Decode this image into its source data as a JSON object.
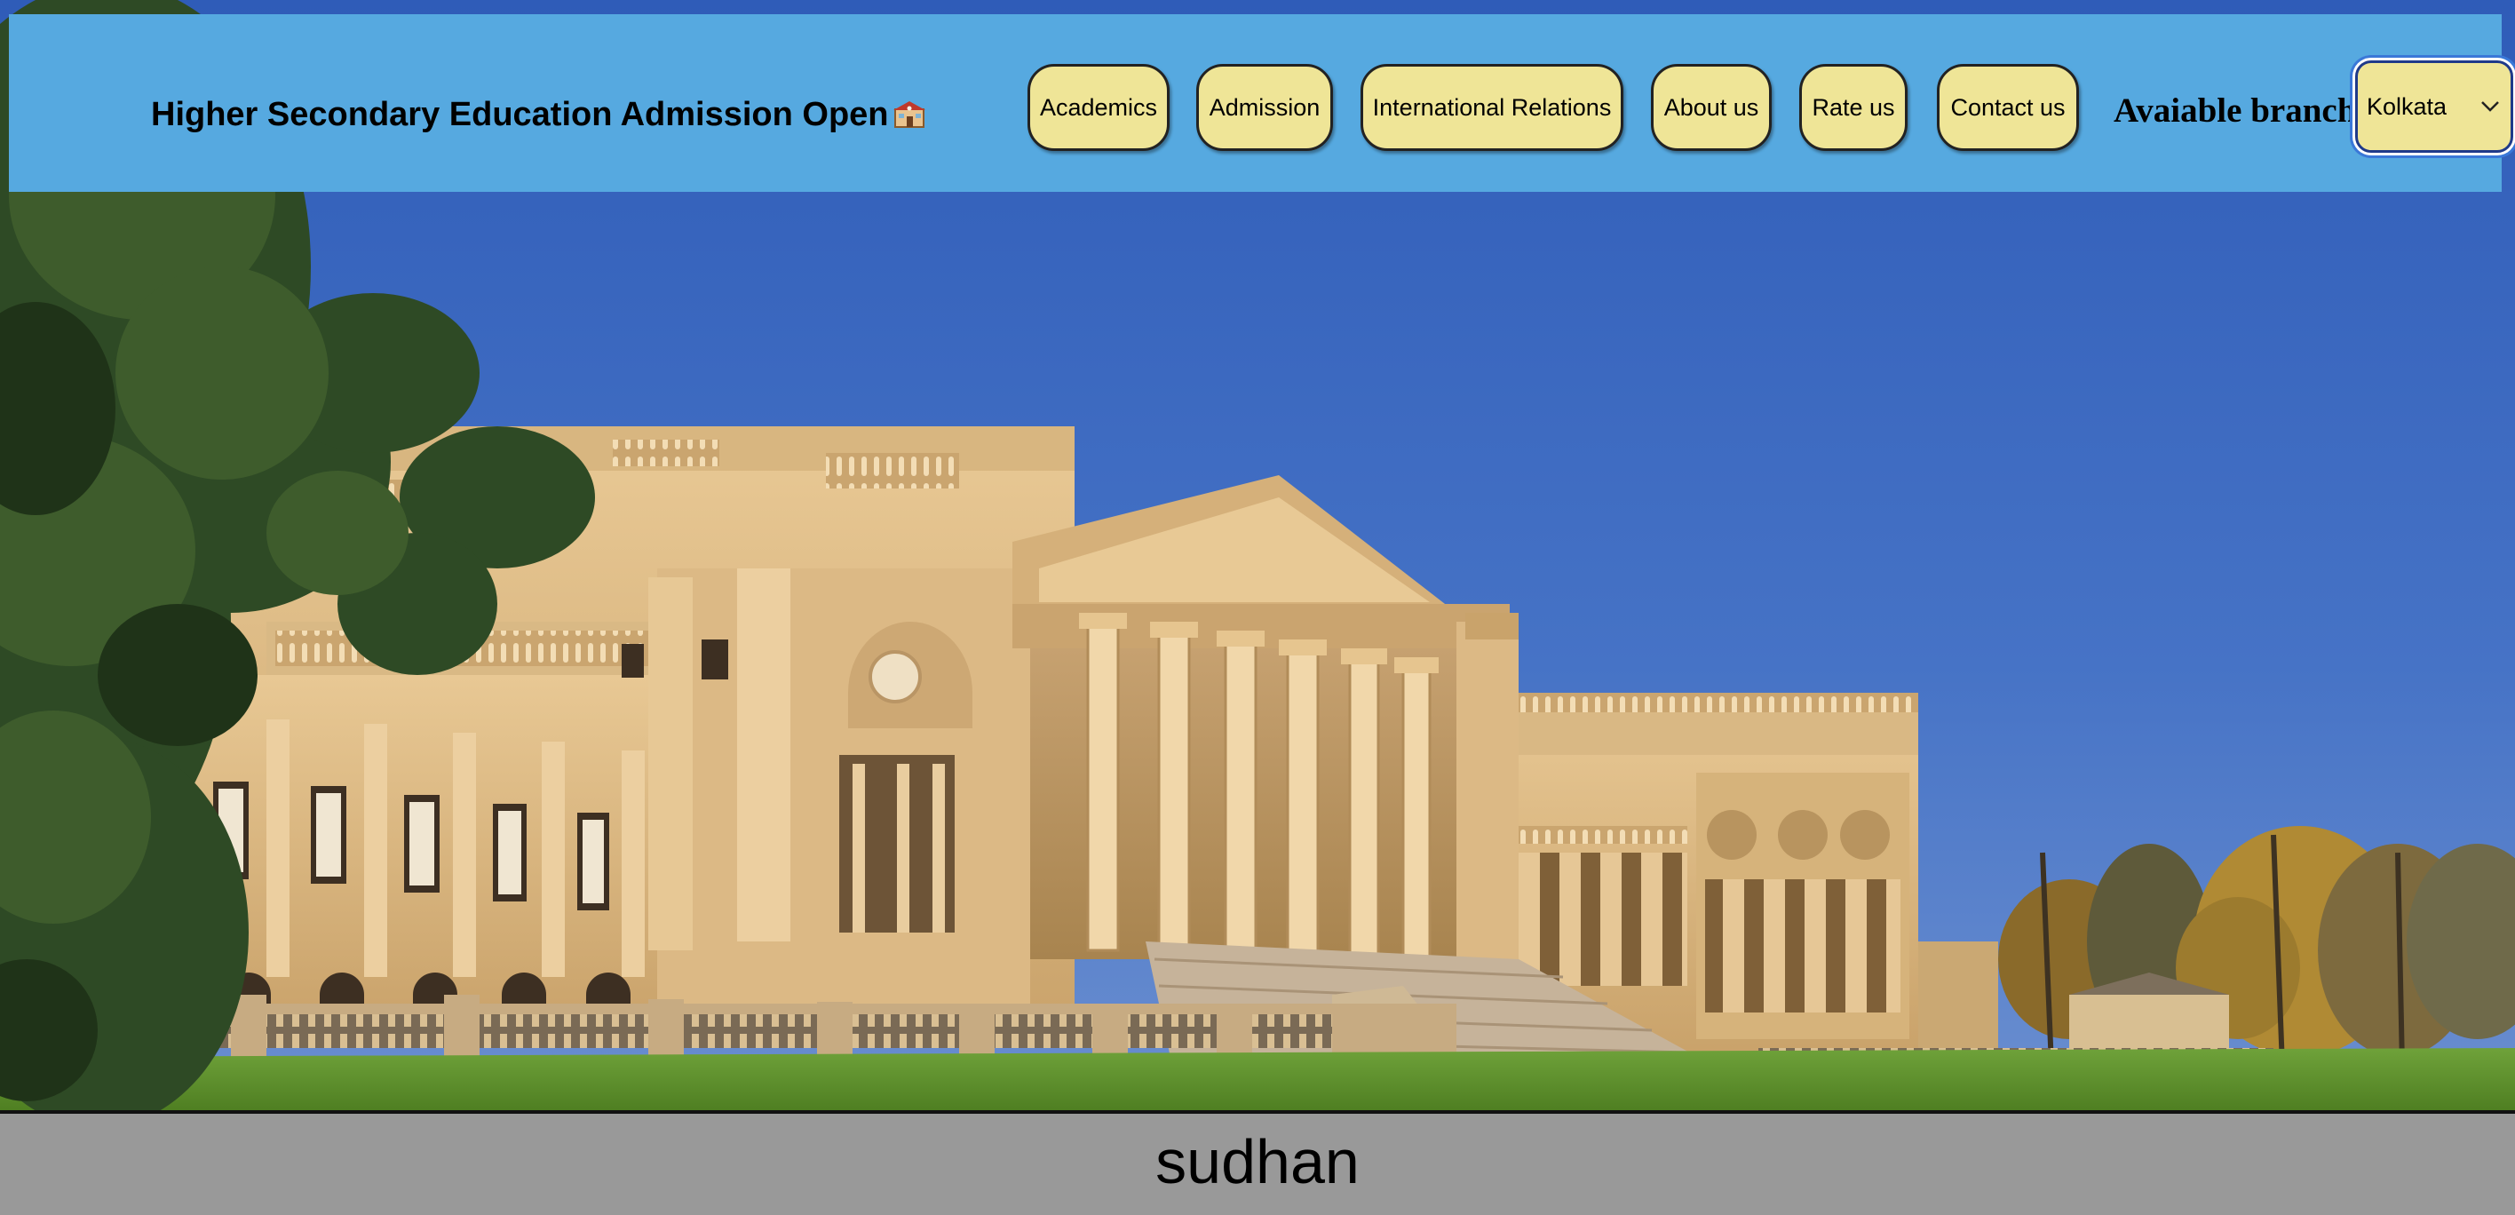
{
  "header": {
    "title": "Higher Secondary Education Admission Open",
    "title_icon": "school-icon"
  },
  "nav": {
    "items": [
      {
        "label": "Academics"
      },
      {
        "label": "Admission"
      },
      {
        "label": "International Relations"
      },
      {
        "label": "About us"
      },
      {
        "label": "Rate us"
      },
      {
        "label": "Contact us"
      }
    ]
  },
  "branch": {
    "label": "Avaiable branch",
    "selected": "Kolkata",
    "icon": "chevron-down-icon"
  },
  "hero": {
    "image": "neoclassical-stately-home-photo"
  },
  "footer": {
    "text": "sudhan"
  },
  "colors": {
    "navbar_bg": "#56a9e0",
    "button_bg": "#efe597",
    "footer_bg": "#999999",
    "sky": "#3b67bd"
  }
}
